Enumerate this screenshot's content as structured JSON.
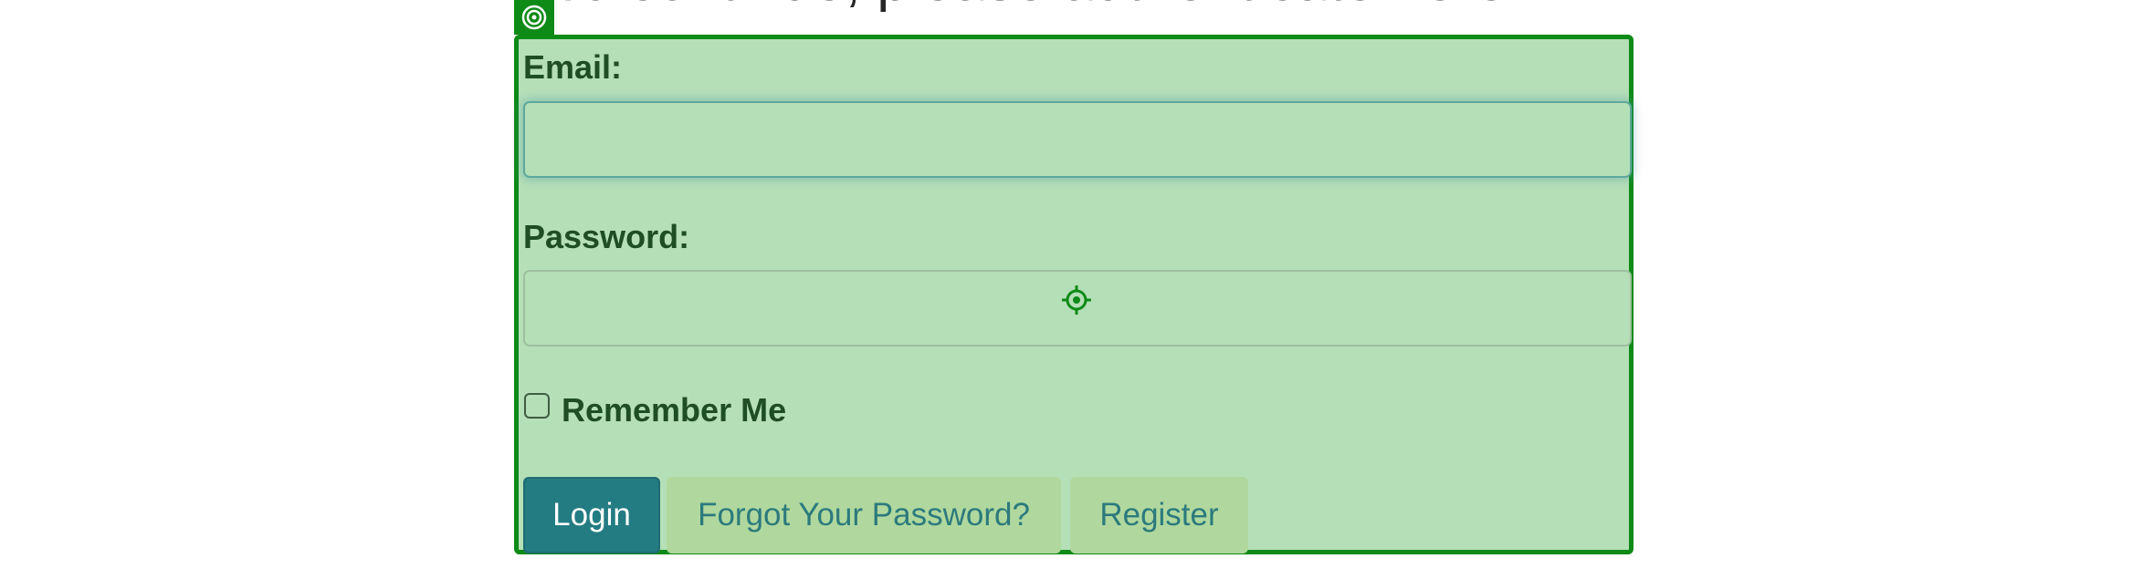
{
  "page": {
    "heading": "To continue, please authenticate here"
  },
  "form": {
    "email_label": "Email:",
    "email_value": "",
    "password_label": "Password:",
    "password_value": "",
    "remember_label": "Remember Me",
    "remember_checked": false
  },
  "buttons": {
    "login": "Login",
    "forgot_password": "Forgot Your Password?",
    "register": "Register"
  },
  "overlay": {
    "badge_icon": "target-icon",
    "cursor_icon": "crosshair-icon",
    "accent_color": "#0e8a17",
    "highlight_color": "#b5dfb7",
    "primary_button_color": "#237c82"
  }
}
